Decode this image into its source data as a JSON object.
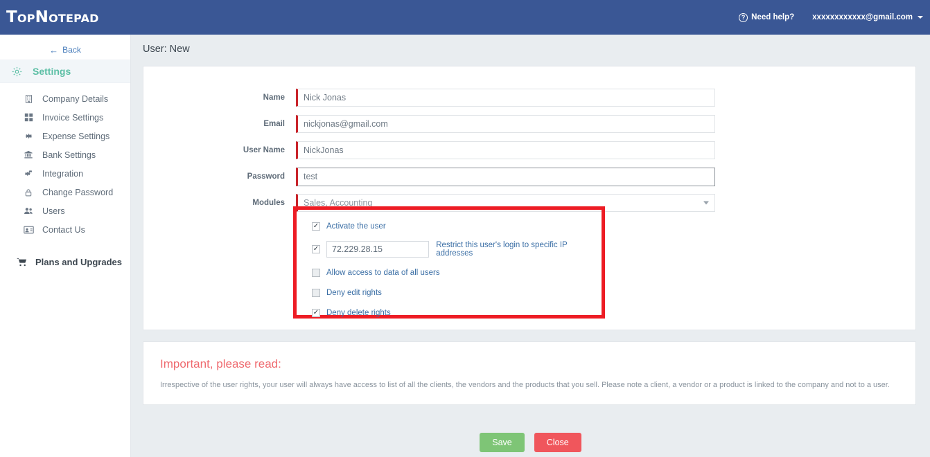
{
  "header": {
    "logo": "TopNotepad",
    "need_help": "Need help?",
    "need_help_icon": "question-circle-icon",
    "user_email": "xxxxxxxxxxxx@gmail.com",
    "brand_color": "#3a5795"
  },
  "sidebar": {
    "back_label": "Back",
    "back_icon": "arrow-left-icon",
    "section": {
      "label": "Settings",
      "icon": "gear-icon",
      "color": "#5cbfa5"
    },
    "items": [
      {
        "label": "Company Details",
        "icon": "building-icon"
      },
      {
        "label": "Invoice Settings",
        "icon": "grid-icon"
      },
      {
        "label": "Expense Settings",
        "icon": "cog-icon"
      },
      {
        "label": "Bank Settings",
        "icon": "bank-icon"
      },
      {
        "label": "Integration",
        "icon": "gears-icon"
      },
      {
        "label": "Change Password",
        "icon": "lock-icon"
      },
      {
        "label": "Users",
        "icon": "users-icon"
      },
      {
        "label": "Contact Us",
        "icon": "contact-card-icon"
      }
    ],
    "upgrade": {
      "label": "Plans and Upgrades",
      "icon": "cart-icon"
    }
  },
  "main": {
    "page_title": "User: New",
    "form": {
      "fields": [
        {
          "label": "Name",
          "value": "Nick Jonas"
        },
        {
          "label": "Email",
          "value": "nickjonas@gmail.com"
        },
        {
          "label": "User Name",
          "value": "NickJonas"
        },
        {
          "label": "Password",
          "value": "test"
        }
      ],
      "modules": {
        "label": "Modules",
        "value": "Sales, Accounting",
        "caret_icon": "caret-down-icon"
      }
    },
    "permissions": {
      "highlight_color": "#ed1c24",
      "activate": {
        "label": "Activate the user",
        "checked": true
      },
      "ip_restrict": {
        "checked": true,
        "value": "72.229.28.15",
        "note": "Restrict this user's login to specific IP addresses"
      },
      "options": [
        {
          "label": "Allow access to data of all users",
          "checked": false
        },
        {
          "label": "Deny edit rights",
          "checked": false
        },
        {
          "label": "Deny delete rights",
          "checked": true
        }
      ]
    },
    "note": {
      "title": "Important, please read:",
      "body": "Irrespective of the user rights, your user will always have access to list of all the clients, the vendors and the products that you sell. Please note a client, a vendor or a product is linked to the company and not to a user."
    },
    "buttons": {
      "save": {
        "label": "Save",
        "color": "#7ec576"
      },
      "close": {
        "label": "Close",
        "color": "#f0565c"
      }
    }
  }
}
